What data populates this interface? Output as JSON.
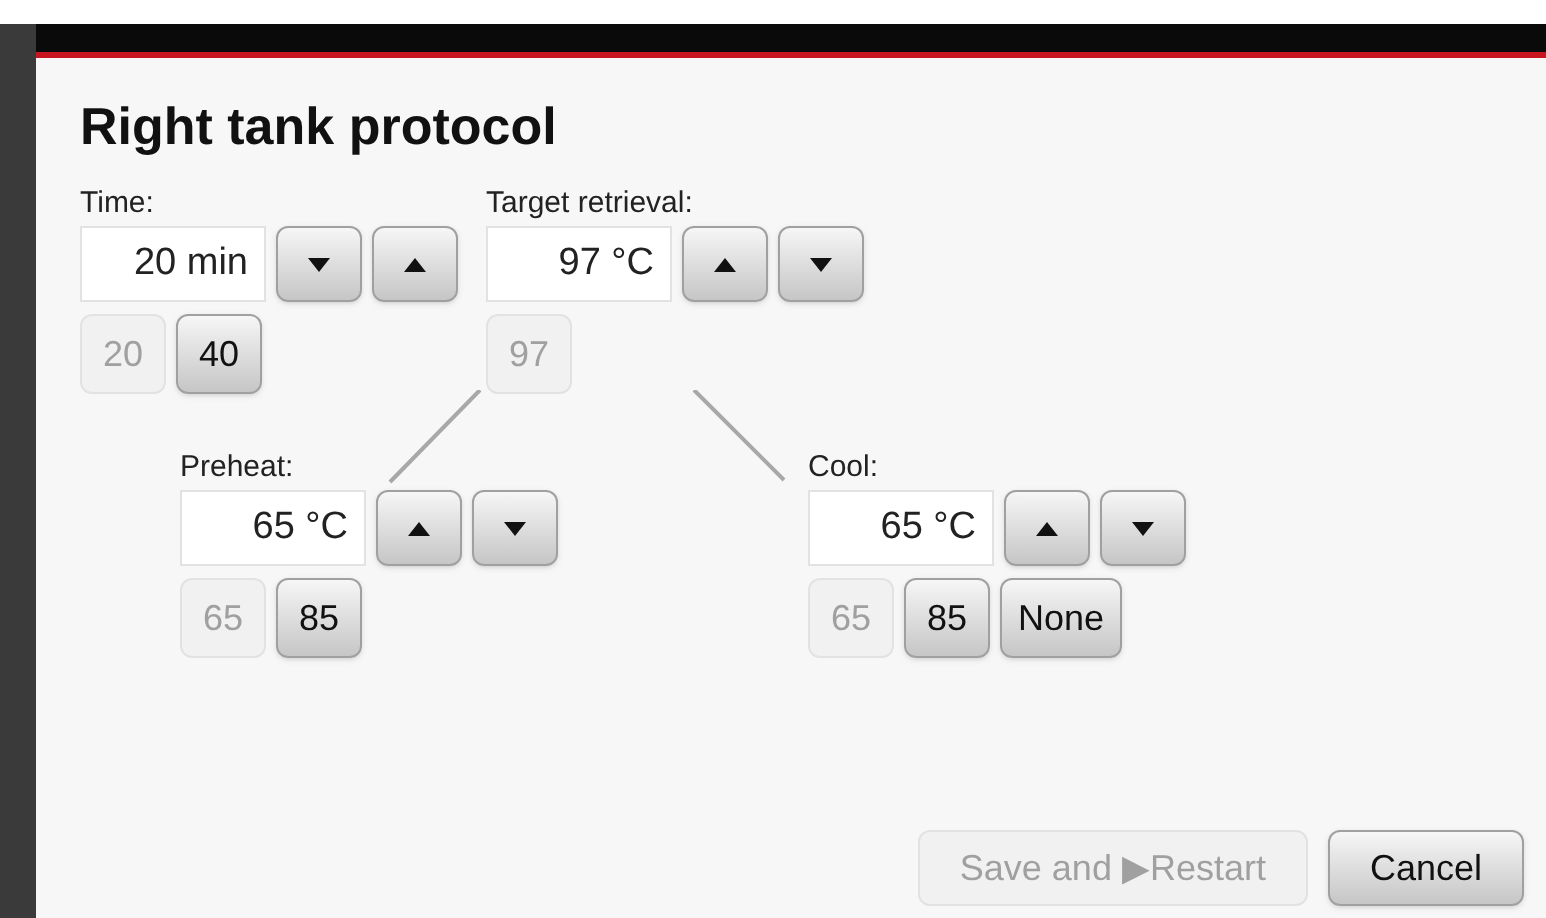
{
  "dialog": {
    "title": "Right tank protocol"
  },
  "top_settings": [
    {
      "label": "Time:",
      "value": "20 min",
      "spin_buttons": [
        {
          "kind": "down"
        },
        {
          "kind": "up"
        }
      ],
      "presets": [
        {
          "label": "20",
          "disabled": true
        },
        {
          "label": "40",
          "disabled": false
        }
      ]
    },
    {
      "label": "Target retrieval:",
      "value": "97 °C",
      "spin_buttons": [
        {
          "kind": "up"
        },
        {
          "kind": "down"
        }
      ],
      "presets": [
        {
          "label": "97",
          "disabled": true
        }
      ]
    }
  ],
  "bottom_settings": [
    {
      "label": "Preheat:",
      "value": "65 °C",
      "spin_buttons": [
        {
          "kind": "up"
        },
        {
          "kind": "down"
        }
      ],
      "presets": [
        {
          "label": "65",
          "disabled": true
        },
        {
          "label": "85",
          "disabled": false
        }
      ]
    },
    {
      "label": "Cool:",
      "value": "65 °C",
      "spin_buttons": [
        {
          "kind": "up"
        },
        {
          "kind": "down"
        }
      ],
      "presets": [
        {
          "label": "65",
          "disabled": true
        },
        {
          "label": "85",
          "disabled": false
        },
        {
          "label": "None",
          "disabled": false
        }
      ]
    }
  ],
  "buttons": [
    {
      "label": "Save and ▶Restart",
      "disabled": true
    },
    {
      "label": "Cancel",
      "disabled": false
    }
  ]
}
